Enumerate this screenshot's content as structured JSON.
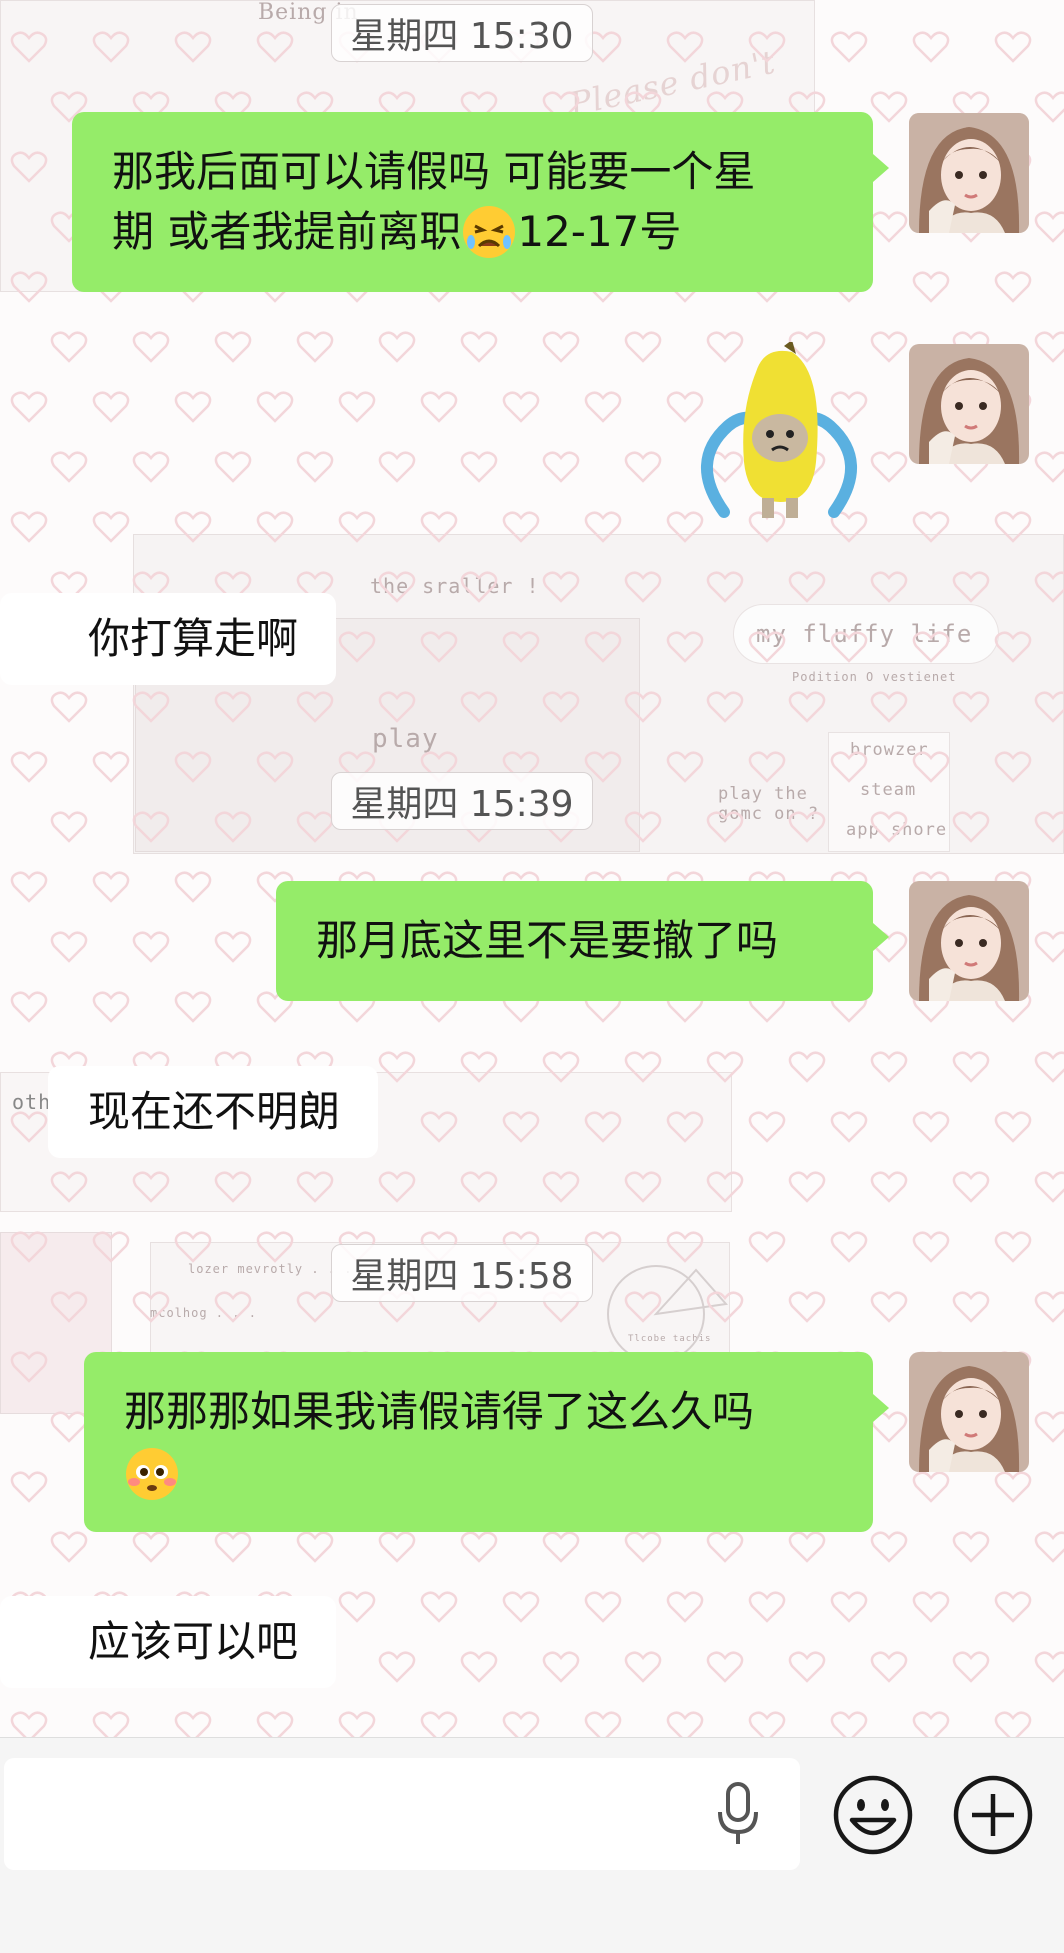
{
  "messages": {
    "time1": "星期四 15:30",
    "msg1_line1": "那我后面可以请假吗 可能要一个星",
    "msg1_line2_a": "期 或者我提前离职",
    "msg1_line2_b": "12-17号",
    "msg2_sticker": "banana-cat-crying-sticker",
    "msg3": "你打算走啊",
    "time2": "星期四 15:39",
    "msg4": "那月底这里不是要撤了吗",
    "msg5": "现在还不明朗",
    "time3": "星期四 15:58",
    "msg6_line1": "那那那如果我请假请得了这么久吗",
    "msg7": "应该可以吧"
  },
  "wallpaper": {
    "texts": [
      "Being in",
      "Please don't",
      "the sraller !",
      "my fluffy life",
      "Podition O vestienet",
      "play",
      "browzer",
      "steam",
      "app shore",
      "play the",
      "gomc on ?",
      "oth",
      "lozer mevrotly . . .",
      "mcolhog . . .",
      "Tlcobe tachis"
    ]
  },
  "icons": {
    "mic": "microphone-icon",
    "emoji": "smiley-face-icon",
    "plus": "plus-circle-icon"
  },
  "colors": {
    "bubble_out": "#95ec69",
    "bubble_in": "#ffffff",
    "bar": "#f5f5f5"
  }
}
